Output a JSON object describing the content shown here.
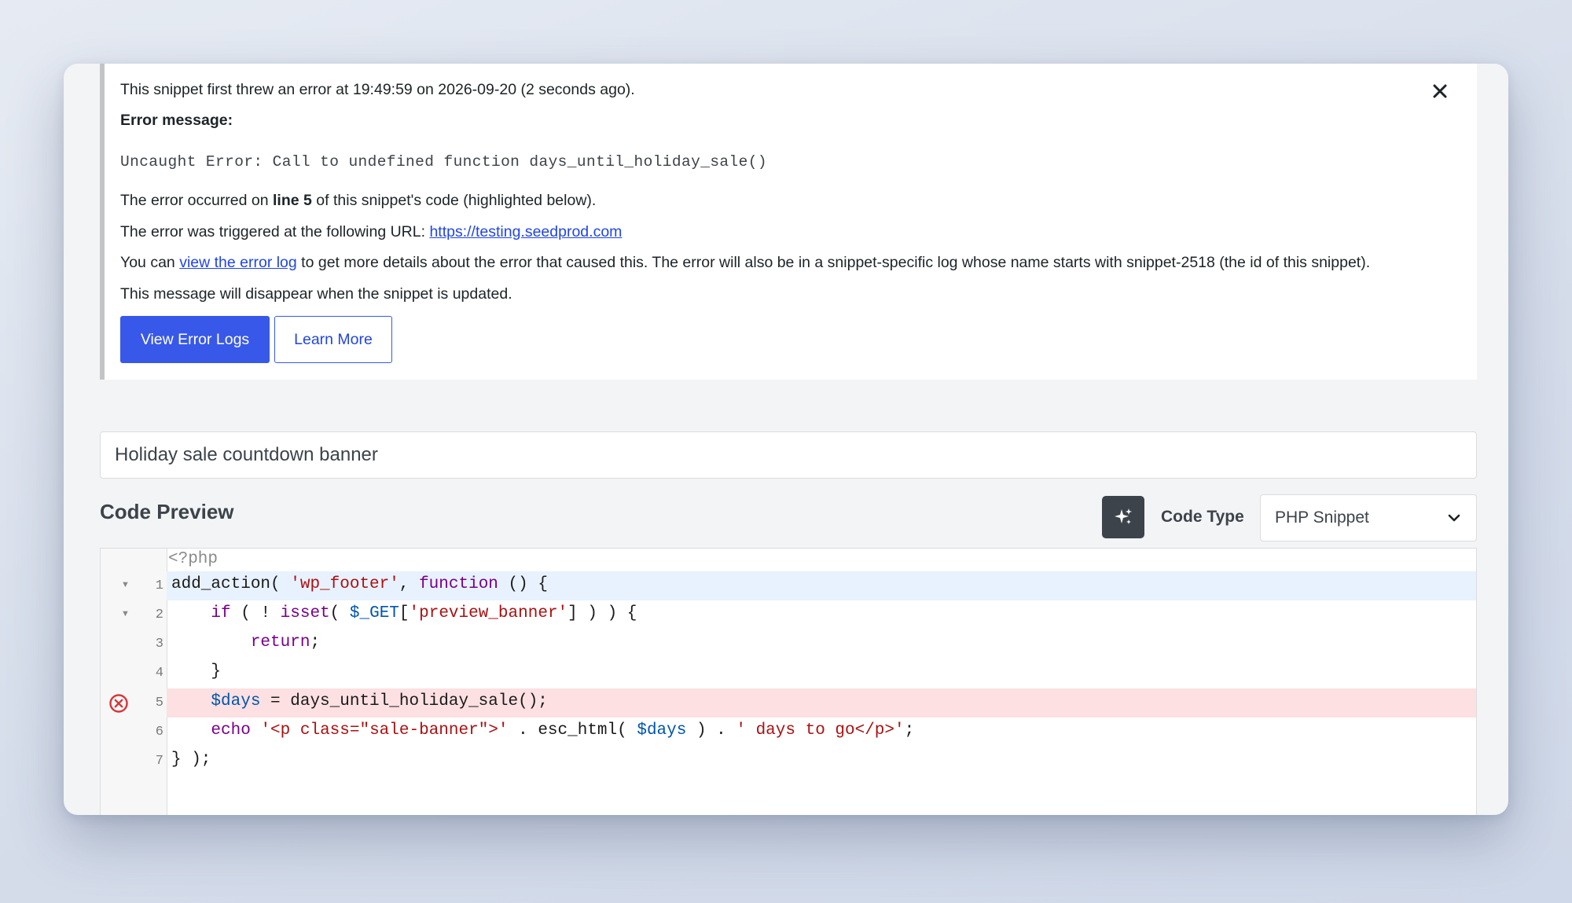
{
  "notice": {
    "first_error": "This snippet first threw an error at 19:49:59 on 2026-09-20 (2 seconds ago).",
    "error_message_label": "Error message:",
    "error_message": "Uncaught Error: Call to undefined function days_until_holiday_sale()",
    "occurred_prefix": "The error occurred on ",
    "occurred_line": "line 5",
    "occurred_suffix": " of this snippet's code (highlighted below).",
    "triggered_prefix": "The error was triggered at the following URL: ",
    "triggered_url": "https://testing.seedprod.com",
    "log_prefix": "You can ",
    "log_link": "view the error log",
    "log_suffix": " to get more details about the error that caused this. The error will also be in a snippet-specific log whose name starts with snippet-2518 (the id of this snippet).",
    "disappear": "This message will disappear when the snippet is updated.",
    "view_logs_button": "View Error Logs",
    "learn_more_button": "Learn More",
    "close_icon": "close-icon"
  },
  "snippet": {
    "title": "Holiday sale countdown banner"
  },
  "preview": {
    "section_title": "Code Preview",
    "ai_icon": "sparkles-icon",
    "code_type_label": "Code Type",
    "code_type_value": "PHP Snippet"
  },
  "editor": {
    "php_open": "<?php",
    "lines": [
      {
        "n": "1",
        "text": "add_action( 'wp_footer', function () {"
      },
      {
        "n": "2",
        "text": "    if ( ! isset( $_GET['preview_banner'] ) ) {"
      },
      {
        "n": "3",
        "text": "        return;"
      },
      {
        "n": "4",
        "text": "    }"
      },
      {
        "n": "5",
        "text": "    $days = days_until_holiday_sale();"
      },
      {
        "n": "6",
        "text": "    echo '<p class=\"sale-banner\">' . esc_html( $days ) . ' days to go</p>';"
      },
      {
        "n": "7",
        "text": "} );"
      }
    ],
    "error_line": 5,
    "active_line": 1
  },
  "colors": {
    "primary": "#3858e9",
    "error_highlight": "#fde0e2",
    "active_highlight": "#e8f2fe",
    "error_icon": "#d63638"
  }
}
